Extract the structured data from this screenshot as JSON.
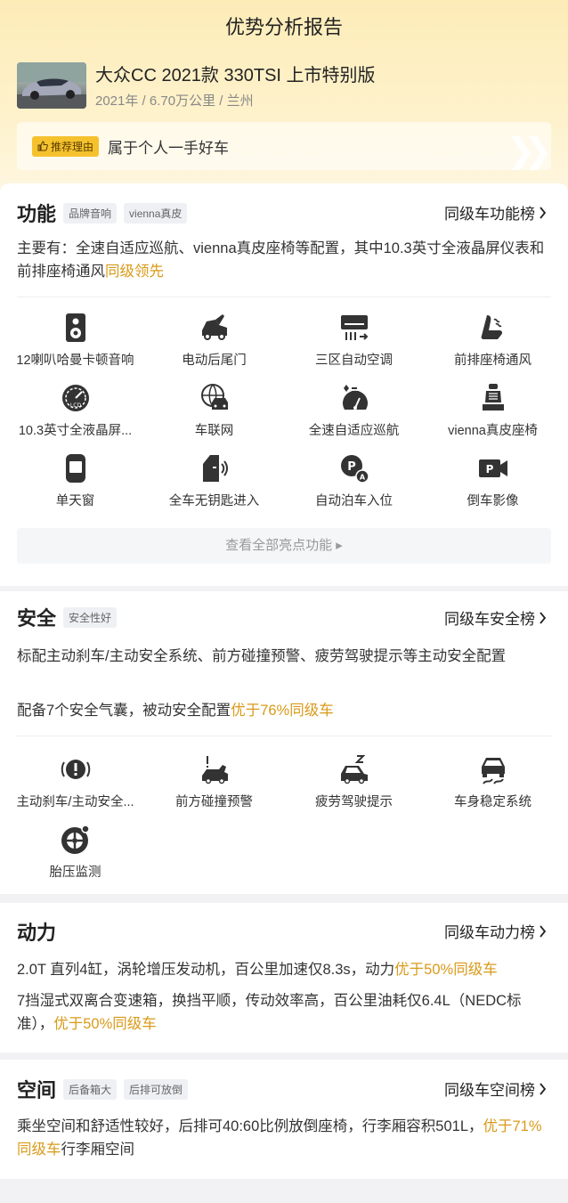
{
  "header": {
    "title": "优势分析报告",
    "car_name": "大众CC 2021款 330TSI 上市特别版",
    "car_meta": "2021年 / 6.70万公里 / 兰州",
    "reason_tag": "推荐理由",
    "reason_text": "属于个人一手好车"
  },
  "function": {
    "title": "功能",
    "tags": [
      "品牌音响",
      "vienna真皮"
    ],
    "rank_link": "同级车功能榜",
    "desc_plain": "主要有：全速自适应巡航、vienna真皮座椅等配置，其中10.3英寸全液晶屏仪表和前排座椅通风",
    "desc_highlight": "同级领先",
    "features": [
      {
        "label": "12喇叭哈曼卡顿音响",
        "icon": "speaker-icon"
      },
      {
        "label": "电动后尾门",
        "icon": "power-tailgate-icon"
      },
      {
        "label": "三区自动空调",
        "icon": "air-conditioner-icon"
      },
      {
        "label": "前排座椅通风",
        "icon": "seat-ventilation-icon"
      },
      {
        "label": "10.3英寸全液晶屏...",
        "icon": "lcd-gauge-icon"
      },
      {
        "label": "车联网",
        "icon": "connected-car-icon"
      },
      {
        "label": "全速自适应巡航",
        "icon": "adaptive-cruise-icon"
      },
      {
        "label": "vienna真皮座椅",
        "icon": "leather-seat-icon"
      },
      {
        "label": "单天窗",
        "icon": "sunroof-icon"
      },
      {
        "label": "全车无钥匙进入",
        "icon": "keyless-entry-icon"
      },
      {
        "label": "自动泊车入位",
        "icon": "auto-parking-icon"
      },
      {
        "label": "倒车影像",
        "icon": "reverse-camera-icon"
      }
    ],
    "all_button": "查看全部亮点功能 ▸"
  },
  "safety": {
    "title": "安全",
    "tags": [
      "安全性好"
    ],
    "rank_link": "同级车安全榜",
    "desc1": "标配主动刹车/主动安全系统、前方碰撞预警、疲劳驾驶提示等主动安全配置",
    "desc2_plain": "配备7个安全气囊，被动安全配置",
    "desc2_highlight": "优于76%同级车",
    "features": [
      {
        "label": "主动刹车/主动安全...",
        "icon": "active-brake-icon"
      },
      {
        "label": "前方碰撞预警",
        "icon": "collision-warning-icon"
      },
      {
        "label": "疲劳驾驶提示",
        "icon": "fatigue-warning-icon"
      },
      {
        "label": "车身稳定系统",
        "icon": "stability-control-icon"
      },
      {
        "label": "胎压监测",
        "icon": "tire-pressure-icon"
      }
    ]
  },
  "power": {
    "title": "动力",
    "rank_link": "同级车动力榜",
    "desc1_plain": "2.0T 直列4缸，涡轮增压发动机，百公里加速仅8.3s，动力",
    "desc1_highlight": "优于50%同级车",
    "desc2_plain": "7挡湿式双离合变速箱，换挡平顺，传动效率高，百公里油耗仅6.4L（NEDC标准），",
    "desc2_highlight": "优于50%同级车"
  },
  "space": {
    "title": "空间",
    "tags": [
      "后备箱大",
      "后排可放倒"
    ],
    "rank_link": "同级车空间榜",
    "desc_plain": "乘坐空间和舒适性较好，后排可40:60比例放倒座椅，行李厢容积501L，",
    "desc_highlight": "优于71%同级车",
    "desc_tail": "行李厢空间"
  },
  "colors": {
    "highlight": "#d99a1a",
    "tag_bg": "#f5c22e",
    "icon": "#333333"
  }
}
